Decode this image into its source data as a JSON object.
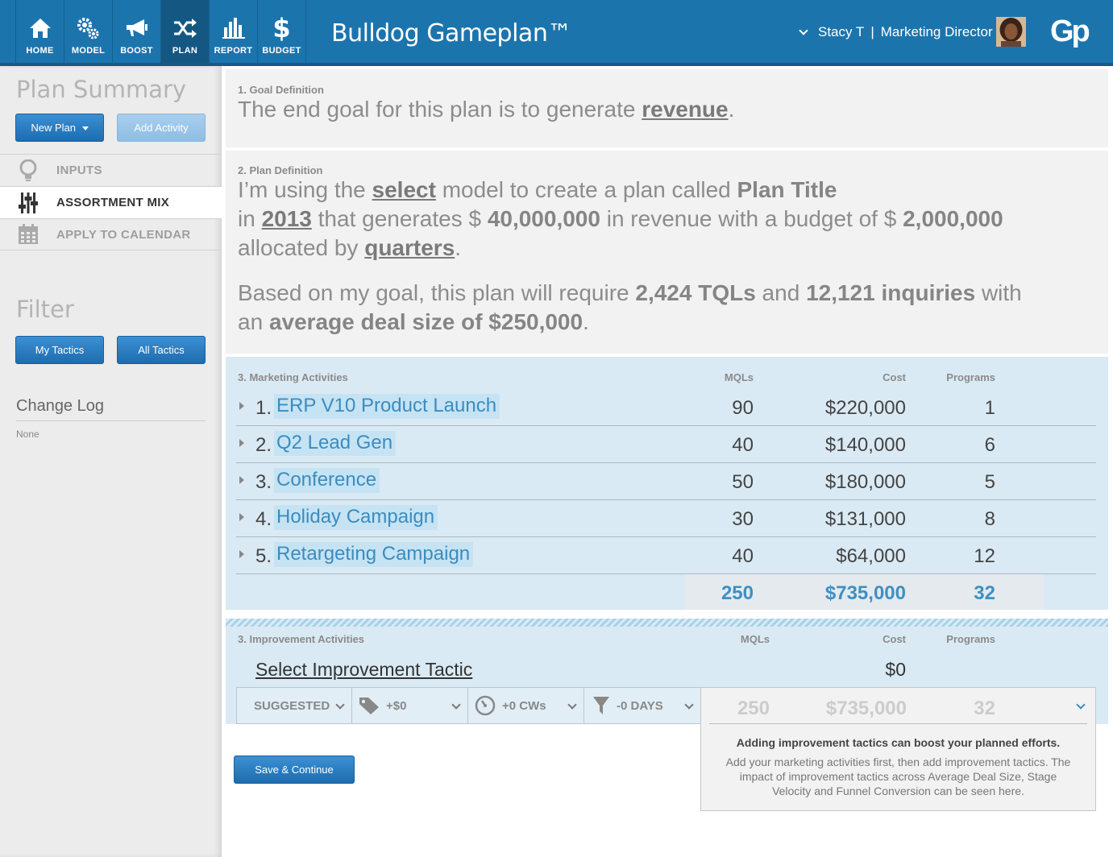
{
  "app": {
    "title": "Bulldog Gameplan™",
    "logo": "Gp"
  },
  "nav": [
    {
      "label": "HOME",
      "icon": "home-icon"
    },
    {
      "label": "MODEL",
      "icon": "gears-icon"
    },
    {
      "label": "BOOST",
      "icon": "megaphone-icon"
    },
    {
      "label": "PLAN",
      "icon": "shuffle-icon",
      "active": true
    },
    {
      "label": "REPORT",
      "icon": "bar-chart-icon"
    },
    {
      "label": "BUDGET",
      "icon": "dollar-icon"
    }
  ],
  "user": {
    "name": "Stacy T",
    "separator": "|",
    "role": "Marketing Director"
  },
  "sidebar": {
    "title": "Plan Summary",
    "new_plan": "New Plan",
    "add_activity": "Add Activity",
    "menu": [
      {
        "label": "INPUTS",
        "icon": "lightbulb-icon"
      },
      {
        "label": "ASSORTMENT MIX",
        "icon": "sliders-icon",
        "active": true
      },
      {
        "label": "APPLY TO CALENDAR",
        "icon": "calendar-icon"
      }
    ],
    "filter_title": "Filter",
    "my_tactics": "My Tactics",
    "all_tactics": "All Tactics",
    "changelog_title": "Change Log",
    "changelog_value": "None"
  },
  "goal": {
    "label": "1. Goal Definition",
    "prefix": "The end goal for this plan is to generate ",
    "goal": "revenue",
    "suffix": "."
  },
  "plan_def": {
    "label": "2. Plan Definition",
    "l1a": "I’m using the ",
    "model": "select",
    "l1b": " model to create a plan called ",
    "plan_title": "Plan Title",
    "l2a": "in ",
    "year": "2013",
    "l2b": " that generates $ ",
    "revenue": "40,000,000",
    "l2c": " in revenue with a budget of $ ",
    "budget": "2,000,000",
    "l3a": "allocated by ",
    "allocation": "quarters",
    "l3b": ".",
    "l4a": "Based on my goal, this plan will require ",
    "tqls": "2,424 TQLs",
    "l4b": " and ",
    "inquiries": "12,121 inquiries",
    "l4c": " with",
    "l5a": "an ",
    "deal": "average deal size of $250,000",
    "l5b": "."
  },
  "activities": {
    "label": "3. Marketing Activities",
    "headers": {
      "mqls": "MQLs",
      "cost": "Cost",
      "programs": "Programs"
    },
    "rows": [
      {
        "num": "1.",
        "name": "ERP V10 Product Launch",
        "mqls": "90",
        "cost": "$220,000",
        "programs": "1"
      },
      {
        "num": "2.",
        "name": "Q2 Lead Gen",
        "mqls": "40",
        "cost": "$140,000",
        "programs": "6"
      },
      {
        "num": "3.",
        "name": "Conference",
        "mqls": "50",
        "cost": "$180,000",
        "programs": "5"
      },
      {
        "num": "4.",
        "name": "Holiday Campaign",
        "mqls": "30",
        "cost": "$131,000",
        "programs": "8"
      },
      {
        "num": "5.",
        "name": "Retargeting Campaign",
        "mqls": "40",
        "cost": "$64,000",
        "programs": "12"
      }
    ],
    "totals": {
      "mqls": "250",
      "cost": "$735,000",
      "programs": "32"
    }
  },
  "improvement": {
    "label": "3. Improvement Activities",
    "headers": {
      "mqls": "MQLs",
      "cost": "Cost",
      "programs": "Programs"
    },
    "select_tactic": "Select Improvement Tactic",
    "cost": "$0",
    "dropdowns": [
      {
        "label": "SUGGESTED",
        "icon": ""
      },
      {
        "label": "+$0",
        "icon": "tag-icon"
      },
      {
        "label": "+0 CWs",
        "icon": "speedometer-icon"
      },
      {
        "label": "-0 DAYS",
        "icon": "funnel-icon"
      }
    ],
    "preview": {
      "mqls": "250",
      "cost": "$735,000",
      "programs": "32"
    },
    "info_title": "Adding improvement tactics can boost your planned efforts.",
    "info_body": "Add your marketing activities first, then add improvement tactics. The impact of improvement tactics across Average Deal Size, Stage Velocity and Funnel Conversion can be seen here."
  },
  "save_continue": "Save & Continue"
}
